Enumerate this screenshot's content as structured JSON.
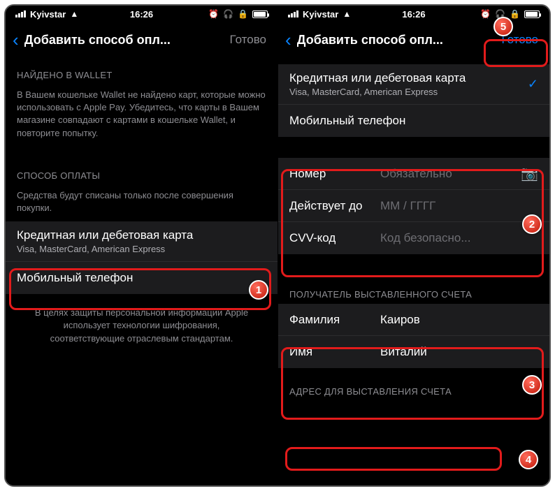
{
  "status": {
    "carrier": "Kyivstar",
    "time": "16:26"
  },
  "nav": {
    "title": "Добавить способ опл...",
    "done": "Готово"
  },
  "left": {
    "wallet_header": "НАЙДЕНО В WALLET",
    "wallet_footer": "В Вашем кошельке Wallet не найдено карт, которые можно использовать с Apple Pay. Убедитесь, что карты в Вашем магазине совпадают с картами в кошельке Wallet, и повторите попытку.",
    "method_header": "СПОСОБ ОПЛАТЫ",
    "method_footer": "Средства будут списаны только после совершения покупки.",
    "card_title": "Кредитная или дебетовая карта",
    "card_sub": "Visa, MasterCard, American Express",
    "phone_title": "Мобильный телефон",
    "privacy_footer": "В целях защиты персональной информации Apple использует технологии шифрования, соответствующие отраслевым стандартам."
  },
  "right": {
    "card_title": "Кредитная или дебетовая карта",
    "card_sub": "Visa, MasterCard, American Express",
    "phone_title": "Мобильный телефон",
    "number_label": "Номер",
    "number_placeholder": "Обязательно",
    "expires_label": "Действует до",
    "expires_placeholder": "ММ  /  ГГГГ",
    "cvv_label": "CVV-код",
    "cvv_placeholder": "Код безопасно...",
    "billto_header": "ПОЛУЧАТЕЛЬ ВЫСТАВЛЕННОГО СЧЕТА",
    "lastname_label": "Фамилия",
    "lastname_value": "Каиров",
    "firstname_label": "Имя",
    "firstname_value": "Виталий",
    "address_header": "АДРЕС ДЛЯ ВЫСТАВЛЕНИЯ СЧЕТА"
  },
  "badges": {
    "b1": "1",
    "b2": "2",
    "b3": "3",
    "b4": "4",
    "b5": "5"
  }
}
